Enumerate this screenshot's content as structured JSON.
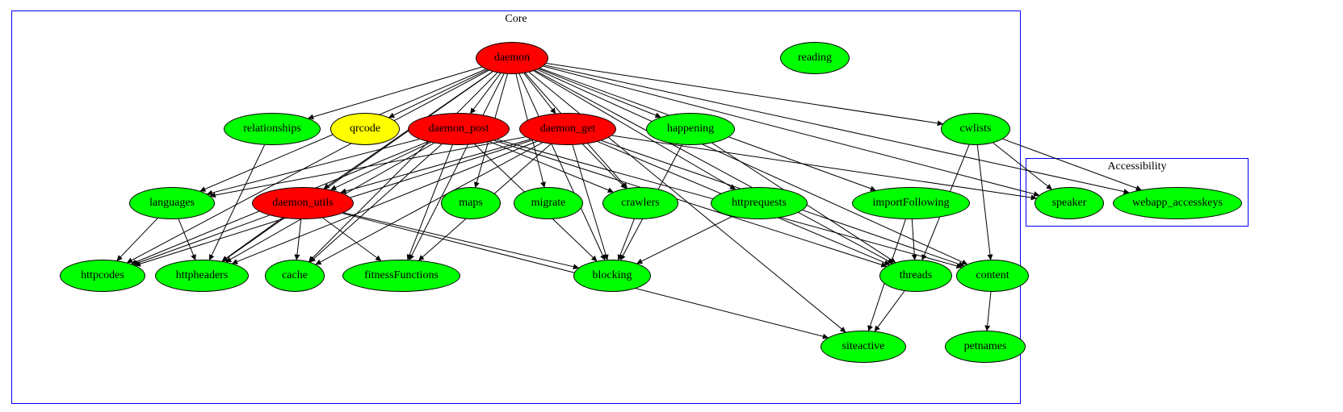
{
  "clusters": {
    "core": {
      "label": "Core"
    },
    "accessibility": {
      "label": "Accessibility"
    }
  },
  "nodes": {
    "daemon": {
      "label": "daemon",
      "color": "red"
    },
    "reading": {
      "label": "reading",
      "color": "green"
    },
    "relationships": {
      "label": "relationships",
      "color": "green"
    },
    "qrcode": {
      "label": "qrcode",
      "color": "yellow"
    },
    "daemon_post": {
      "label": "daemon_post",
      "color": "red"
    },
    "daemon_get": {
      "label": "daemon_get",
      "color": "red"
    },
    "happening": {
      "label": "happening",
      "color": "green"
    },
    "cwlists": {
      "label": "cwlists",
      "color": "green"
    },
    "languages": {
      "label": "languages",
      "color": "green"
    },
    "daemon_utils": {
      "label": "daemon_utils",
      "color": "red"
    },
    "maps": {
      "label": "maps",
      "color": "green"
    },
    "migrate": {
      "label": "migrate",
      "color": "green"
    },
    "crawlers": {
      "label": "crawlers",
      "color": "green"
    },
    "httprequests": {
      "label": "httprequests",
      "color": "green"
    },
    "importFollowing": {
      "label": "importFollowing",
      "color": "green"
    },
    "speaker": {
      "label": "speaker",
      "color": "green"
    },
    "webapp_accesskeys": {
      "label": "webapp_accesskeys",
      "color": "green"
    },
    "httpcodes": {
      "label": "httpcodes",
      "color": "green"
    },
    "httpheaders": {
      "label": "httpheaders",
      "color": "green"
    },
    "cache": {
      "label": "cache",
      "color": "green"
    },
    "fitnessFunctions": {
      "label": "fitnessFunctions",
      "color": "green"
    },
    "blocking": {
      "label": "blocking",
      "color": "green"
    },
    "threads": {
      "label": "threads",
      "color": "green"
    },
    "content": {
      "label": "content",
      "color": "green"
    },
    "siteactive": {
      "label": "siteactive",
      "color": "green"
    },
    "petnames": {
      "label": "petnames",
      "color": "green"
    }
  },
  "edges": [
    [
      "daemon",
      "relationships"
    ],
    [
      "daemon",
      "qrcode"
    ],
    [
      "daemon",
      "daemon_post"
    ],
    [
      "daemon",
      "daemon_get"
    ],
    [
      "daemon",
      "happening"
    ],
    [
      "daemon",
      "cwlists"
    ],
    [
      "daemon",
      "languages"
    ],
    [
      "daemon",
      "daemon_utils"
    ],
    [
      "daemon",
      "maps"
    ],
    [
      "daemon",
      "migrate"
    ],
    [
      "daemon",
      "crawlers"
    ],
    [
      "daemon",
      "httprequests"
    ],
    [
      "daemon",
      "importFollowing"
    ],
    [
      "daemon",
      "httpcodes"
    ],
    [
      "daemon",
      "httpheaders"
    ],
    [
      "daemon",
      "cache"
    ],
    [
      "daemon",
      "fitnessFunctions"
    ],
    [
      "daemon",
      "blocking"
    ],
    [
      "daemon",
      "threads"
    ],
    [
      "daemon",
      "content"
    ],
    [
      "daemon",
      "siteactive"
    ],
    [
      "daemon",
      "speaker"
    ],
    [
      "daemon",
      "webapp_accesskeys"
    ],
    [
      "daemon_post",
      "daemon_utils"
    ],
    [
      "daemon_post",
      "httpcodes"
    ],
    [
      "daemon_post",
      "httpheaders"
    ],
    [
      "daemon_post",
      "cache"
    ],
    [
      "daemon_post",
      "fitnessFunctions"
    ],
    [
      "daemon_post",
      "blocking"
    ],
    [
      "daemon_post",
      "crawlers"
    ],
    [
      "daemon_post",
      "threads"
    ],
    [
      "daemon_post",
      "content"
    ],
    [
      "daemon_post",
      "languages"
    ],
    [
      "daemon_get",
      "daemon_utils"
    ],
    [
      "daemon_get",
      "httpcodes"
    ],
    [
      "daemon_get",
      "httpheaders"
    ],
    [
      "daemon_get",
      "cache"
    ],
    [
      "daemon_get",
      "fitnessFunctions"
    ],
    [
      "daemon_get",
      "blocking"
    ],
    [
      "daemon_get",
      "crawlers"
    ],
    [
      "daemon_get",
      "threads"
    ],
    [
      "daemon_get",
      "content"
    ],
    [
      "daemon_get",
      "languages"
    ],
    [
      "daemon_get",
      "speaker"
    ],
    [
      "relationships",
      "httpheaders"
    ],
    [
      "happening",
      "blocking"
    ],
    [
      "happening",
      "threads"
    ],
    [
      "cwlists",
      "content"
    ],
    [
      "cwlists",
      "threads"
    ],
    [
      "cwlists",
      "speaker"
    ],
    [
      "cwlists",
      "webapp_accesskeys"
    ],
    [
      "languages",
      "httpcodes"
    ],
    [
      "languages",
      "httpheaders"
    ],
    [
      "daemon_utils",
      "httpcodes"
    ],
    [
      "daemon_utils",
      "httpheaders"
    ],
    [
      "daemon_utils",
      "cache"
    ],
    [
      "daemon_utils",
      "fitnessFunctions"
    ],
    [
      "daemon_utils",
      "blocking"
    ],
    [
      "daemon_utils",
      "siteactive"
    ],
    [
      "crawlers",
      "blocking"
    ],
    [
      "httprequests",
      "blocking"
    ],
    [
      "importFollowing",
      "threads"
    ],
    [
      "importFollowing",
      "siteactive"
    ],
    [
      "threads",
      "siteactive"
    ],
    [
      "content",
      "petnames"
    ]
  ]
}
